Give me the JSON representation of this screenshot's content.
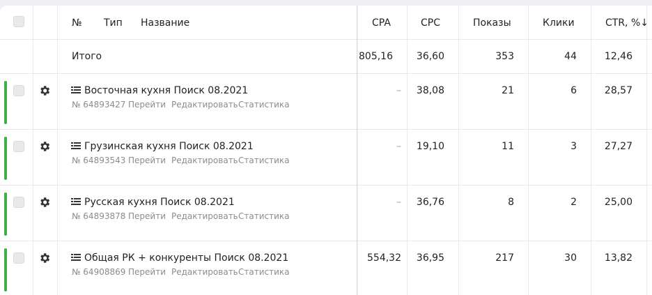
{
  "header": {
    "no_label": "№",
    "type_label": "Тип",
    "name_label": "Название",
    "cpa_label": "CPA",
    "cpc_label": "CPC",
    "shows_label": "Показы",
    "clicks_label": "Клики",
    "ctr_label": "CTR, %",
    "sort_arrow": "↓"
  },
  "total": {
    "label": "Итого",
    "cpa": "805,16",
    "cpc": "36,60",
    "shows": "353",
    "clicks": "44",
    "ctr": "12,46"
  },
  "actions": {
    "goto": "Перейти",
    "edit": "Редактировать",
    "stats": "Статистика"
  },
  "campaigns": [
    {
      "name": "Восточная кухня Поиск 08.2021",
      "number": "№ 64893427",
      "cpa": "–",
      "cpc": "38,08",
      "shows": "21",
      "clicks": "6",
      "ctr": "28,57"
    },
    {
      "name": "Грузинская кухня Поиск 08.2021",
      "number": "№ 64893543",
      "cpa": "–",
      "cpc": "19,10",
      "shows": "11",
      "clicks": "3",
      "ctr": "27,27"
    },
    {
      "name": "Русская кухня Поиск 08.2021",
      "number": "№ 64893878",
      "cpa": "–",
      "cpc": "36,76",
      "shows": "8",
      "clicks": "2",
      "ctr": "25,00"
    },
    {
      "name": "Общая РК + конкуренты Поиск 08.2021",
      "number": "№ 64908869",
      "cpa": "554,32",
      "cpc": "36,95",
      "shows": "217",
      "clicks": "30",
      "ctr": "13,82"
    }
  ],
  "colors": {
    "status_active": "#3fae4a",
    "muted_text": "#8b8b8b"
  }
}
